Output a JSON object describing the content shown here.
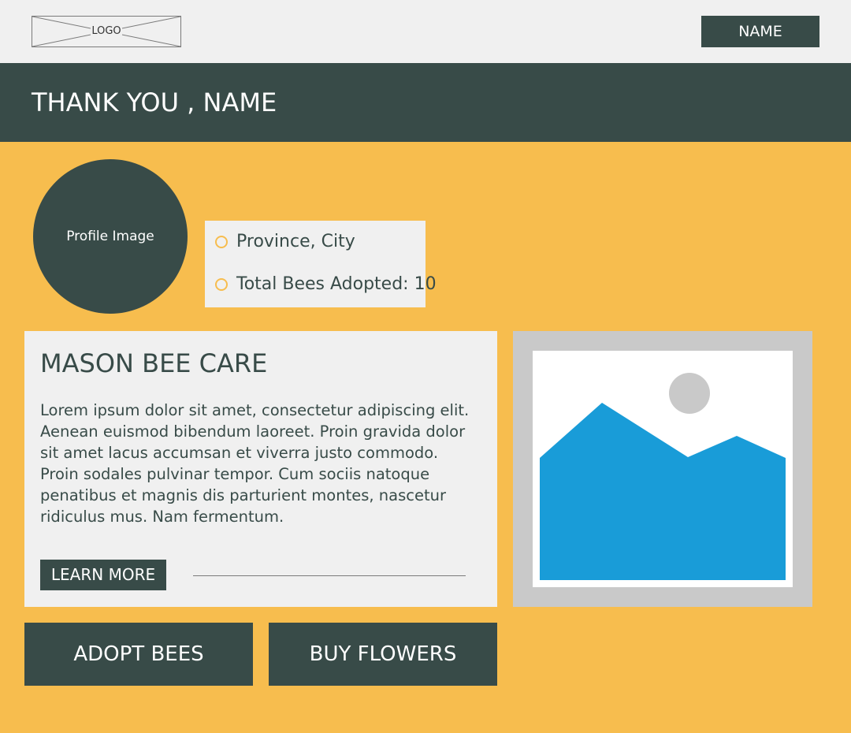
{
  "header": {
    "logo_label": "LOGO",
    "name_button_label": "NAME"
  },
  "banner": {
    "title": "THANK YOU , NAME"
  },
  "profile": {
    "image_label": "Profile Image",
    "location": "Province, City",
    "bees_adopted": "Total Bees Adopted: 10",
    "bullet_icon": "circle-outline-icon"
  },
  "care_card": {
    "title": "MASON BEE CARE",
    "body": "Lorem ipsum dolor sit amet, consectetur adipiscing elit. Aenean euismod bibendum laoreet. Proin gravida dolor sit amet lacus accumsan et viverra justo commodo. Proin sodales pulvinar tempor. Cum sociis natoque penatibus et magnis dis parturient montes, nascetur ridiculus mus. Nam fermentum.",
    "button_label": "LEARN MORE"
  },
  "image_placeholder": {
    "icon": "image-placeholder-icon"
  },
  "actions": {
    "adopt_label": "ADOPT BEES",
    "flowers_label": "BUY FLOWERS"
  },
  "colors": {
    "background": "#f7bd4e",
    "dark": "#384b48",
    "panel": "#f0f0f0",
    "frame": "#c9c9c9",
    "image_blue": "#199cd8",
    "image_sun": "#c9c9c9"
  }
}
